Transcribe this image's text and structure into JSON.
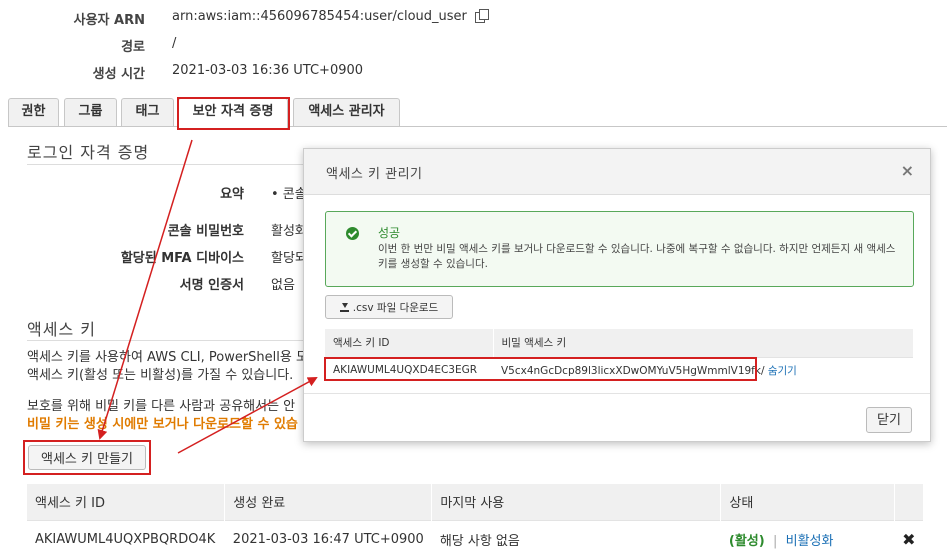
{
  "summary": [
    {
      "label": "사용자 ARN",
      "value": "arn:aws:iam::456096785454:user/cloud_user"
    },
    {
      "label": "경로",
      "value": "/"
    },
    {
      "label": "생성 시간",
      "value": "2021-03-03 16:36 UTC+0900"
    }
  ],
  "tabs": [
    "권한",
    "그룹",
    "태그",
    "보안 자격 증명",
    "액세스 관리자"
  ],
  "active_tab": "보안 자격 증명",
  "login_section": {
    "title": "로그인 자격 증명",
    "rows": [
      {
        "label": "요약",
        "value": "•  콘솔"
      },
      {
        "label": "콘솔 비밀번호",
        "value": "활성화"
      },
      {
        "label": "할당된 MFA 디바이스",
        "value": "할당되"
      },
      {
        "label": "서명 인증서",
        "value": "없음"
      }
    ]
  },
  "access_keys_section": {
    "title": "액세스 키",
    "desc1": "액세스 키를 사용하여 AWS CLI, PowerShell용 도구",
    "desc2": "액세스 키(활성 또는 비활성)를 가질 수 있습니다.",
    "note": "보호를 위해 비밀 키를 다른 사람과 공유해서는 안",
    "warning": "비밀 키는 생성 시에만 보거나 다운로드할 수 있습",
    "create_button": "액세스 키 만들기",
    "table": {
      "headers": [
        "액세스 키 ID",
        "생성 완료",
        "마지막 사용",
        "상태"
      ],
      "rows": [
        {
          "id": "AKIAWUML4UQXPBQRDO4K",
          "created": "2021-03-03 16:47 UTC+0900",
          "last_used": "해당 사항 없음",
          "status": "(활성)",
          "toggle": "비활성화"
        }
      ]
    }
  },
  "modal": {
    "title": "액세스 키 관리기",
    "alert_title": "성공",
    "alert_message": "이번 한 번만 비밀 액세스 키를 보거나 다운로드할 수 있습니다. 나중에 복구할 수 없습니다. 하지만 언제든지 새 액세스 키를 생성할 수 있습니다.",
    "download_button": ".csv 파일 다운로드",
    "table_headers": [
      "액세스 키 ID",
      "비밀 액세스 키"
    ],
    "access_key_id": "AKIAWUML4UQXD4EC3EGR",
    "secret_key": "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",
    "hide_link": "숨기기",
    "close_button": "닫기"
  },
  "colors": {
    "highlight": "#d42020",
    "warning": "#e07b00",
    "active": "#2e8b2e",
    "link": "#1a6fb5"
  }
}
